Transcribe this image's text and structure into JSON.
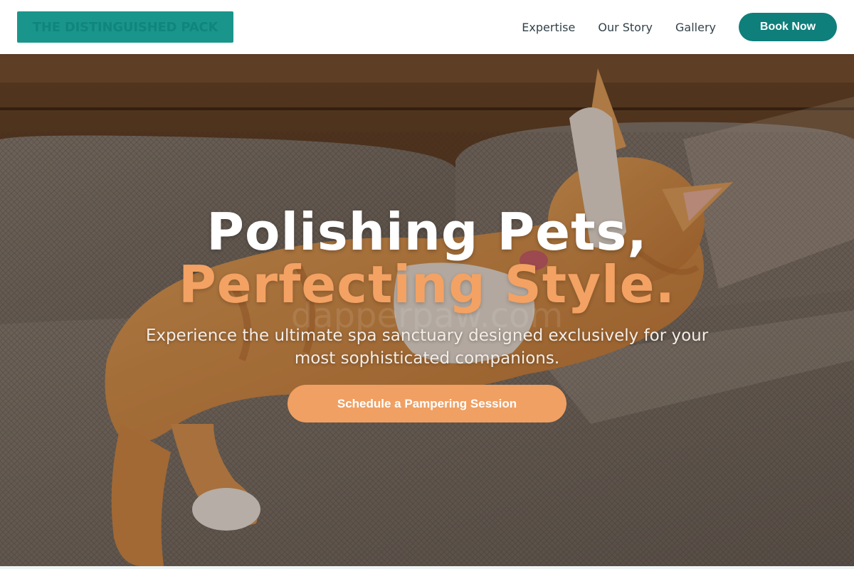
{
  "header": {
    "logo_text": "THE DISTINGUISHED PACK",
    "nav_links": [
      "Expertise",
      "Our Story",
      "Gallery"
    ],
    "cta_label": "Book Now"
  },
  "hero": {
    "headline_line1": "Polishing Pets,",
    "headline_line2": "Perfecting Style.",
    "watermark": "dapperpaw.com",
    "subtitle": "Experience the ultimate spa sanctuary designed exclusively for your most sophisticated companions.",
    "cta_label": "Schedule a Pampering Session",
    "image_subject": "orange tabby cat lounging on a beige sofa"
  },
  "colors": {
    "brand_teal": "#0e7f7b",
    "logo_bg": "#1a958c",
    "accent_orange": "#f0a062",
    "headline_white": "#ffffff",
    "nav_text": "#33424a"
  }
}
